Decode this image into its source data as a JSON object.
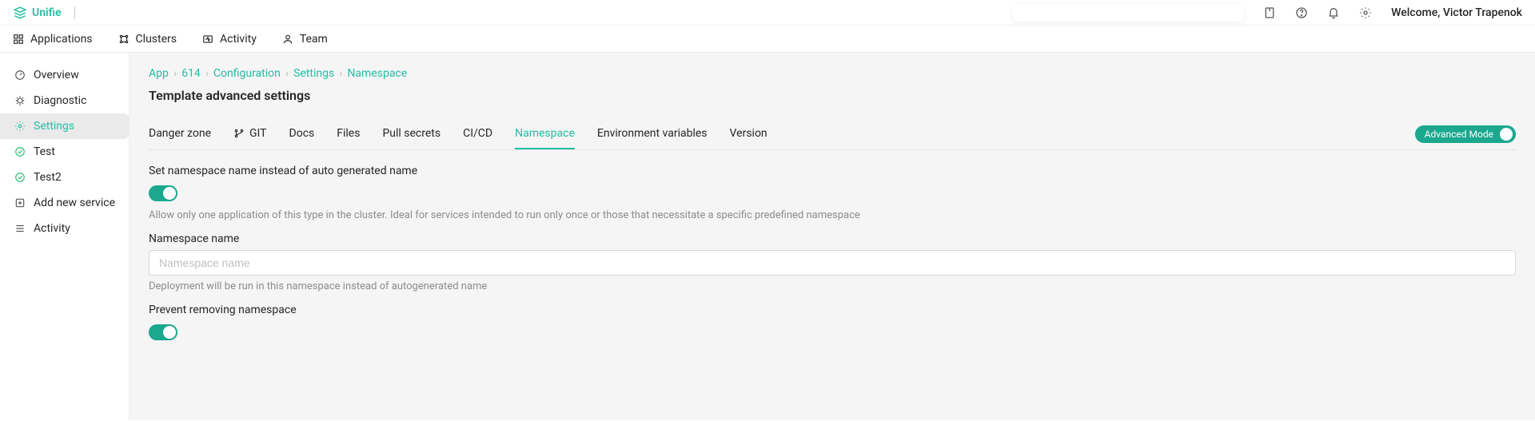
{
  "brand": {
    "name": "Unifie"
  },
  "header": {
    "welcome": "Welcome, Victor Trapenok"
  },
  "mainnav": {
    "applications": "Applications",
    "clusters": "Clusters",
    "activity": "Activity",
    "team": "Team"
  },
  "sidebar": {
    "overview": "Overview",
    "diagnostic": "Diagnostic",
    "settings": "Settings",
    "test": "Test",
    "test2": "Test2",
    "add_new_service": "Add new service",
    "activity": "Activity"
  },
  "breadcrumb": {
    "app": "App",
    "id": "614",
    "configuration": "Configuration",
    "settings": "Settings",
    "namespace": "Namespace"
  },
  "page": {
    "title": "Template advanced settings"
  },
  "tabs": {
    "danger_zone": "Danger zone",
    "git": "GIT",
    "docs": "Docs",
    "files": "Files",
    "pull_secrets": "Pull secrets",
    "cicd": "CI/CD",
    "namespace": "Namespace",
    "env_vars": "Environment variables",
    "version": "Version"
  },
  "advanced_mode": {
    "label": "Advanced Mode",
    "on": true
  },
  "form": {
    "set_namespace_label": "Set namespace name instead of auto generated name",
    "set_namespace_on": true,
    "set_namespace_desc": "Allow only one application of this type in the cluster. Ideal for services intended to run only once or those that necessitate a specific predefined namespace",
    "namespace_name_label": "Namespace name",
    "namespace_name_value": "",
    "namespace_name_placeholder": "Namespace name",
    "namespace_name_help": "Deployment will be run in this namespace instead of autogenerated name",
    "prevent_remove_label": "Prevent removing namespace",
    "prevent_remove_on": true
  }
}
